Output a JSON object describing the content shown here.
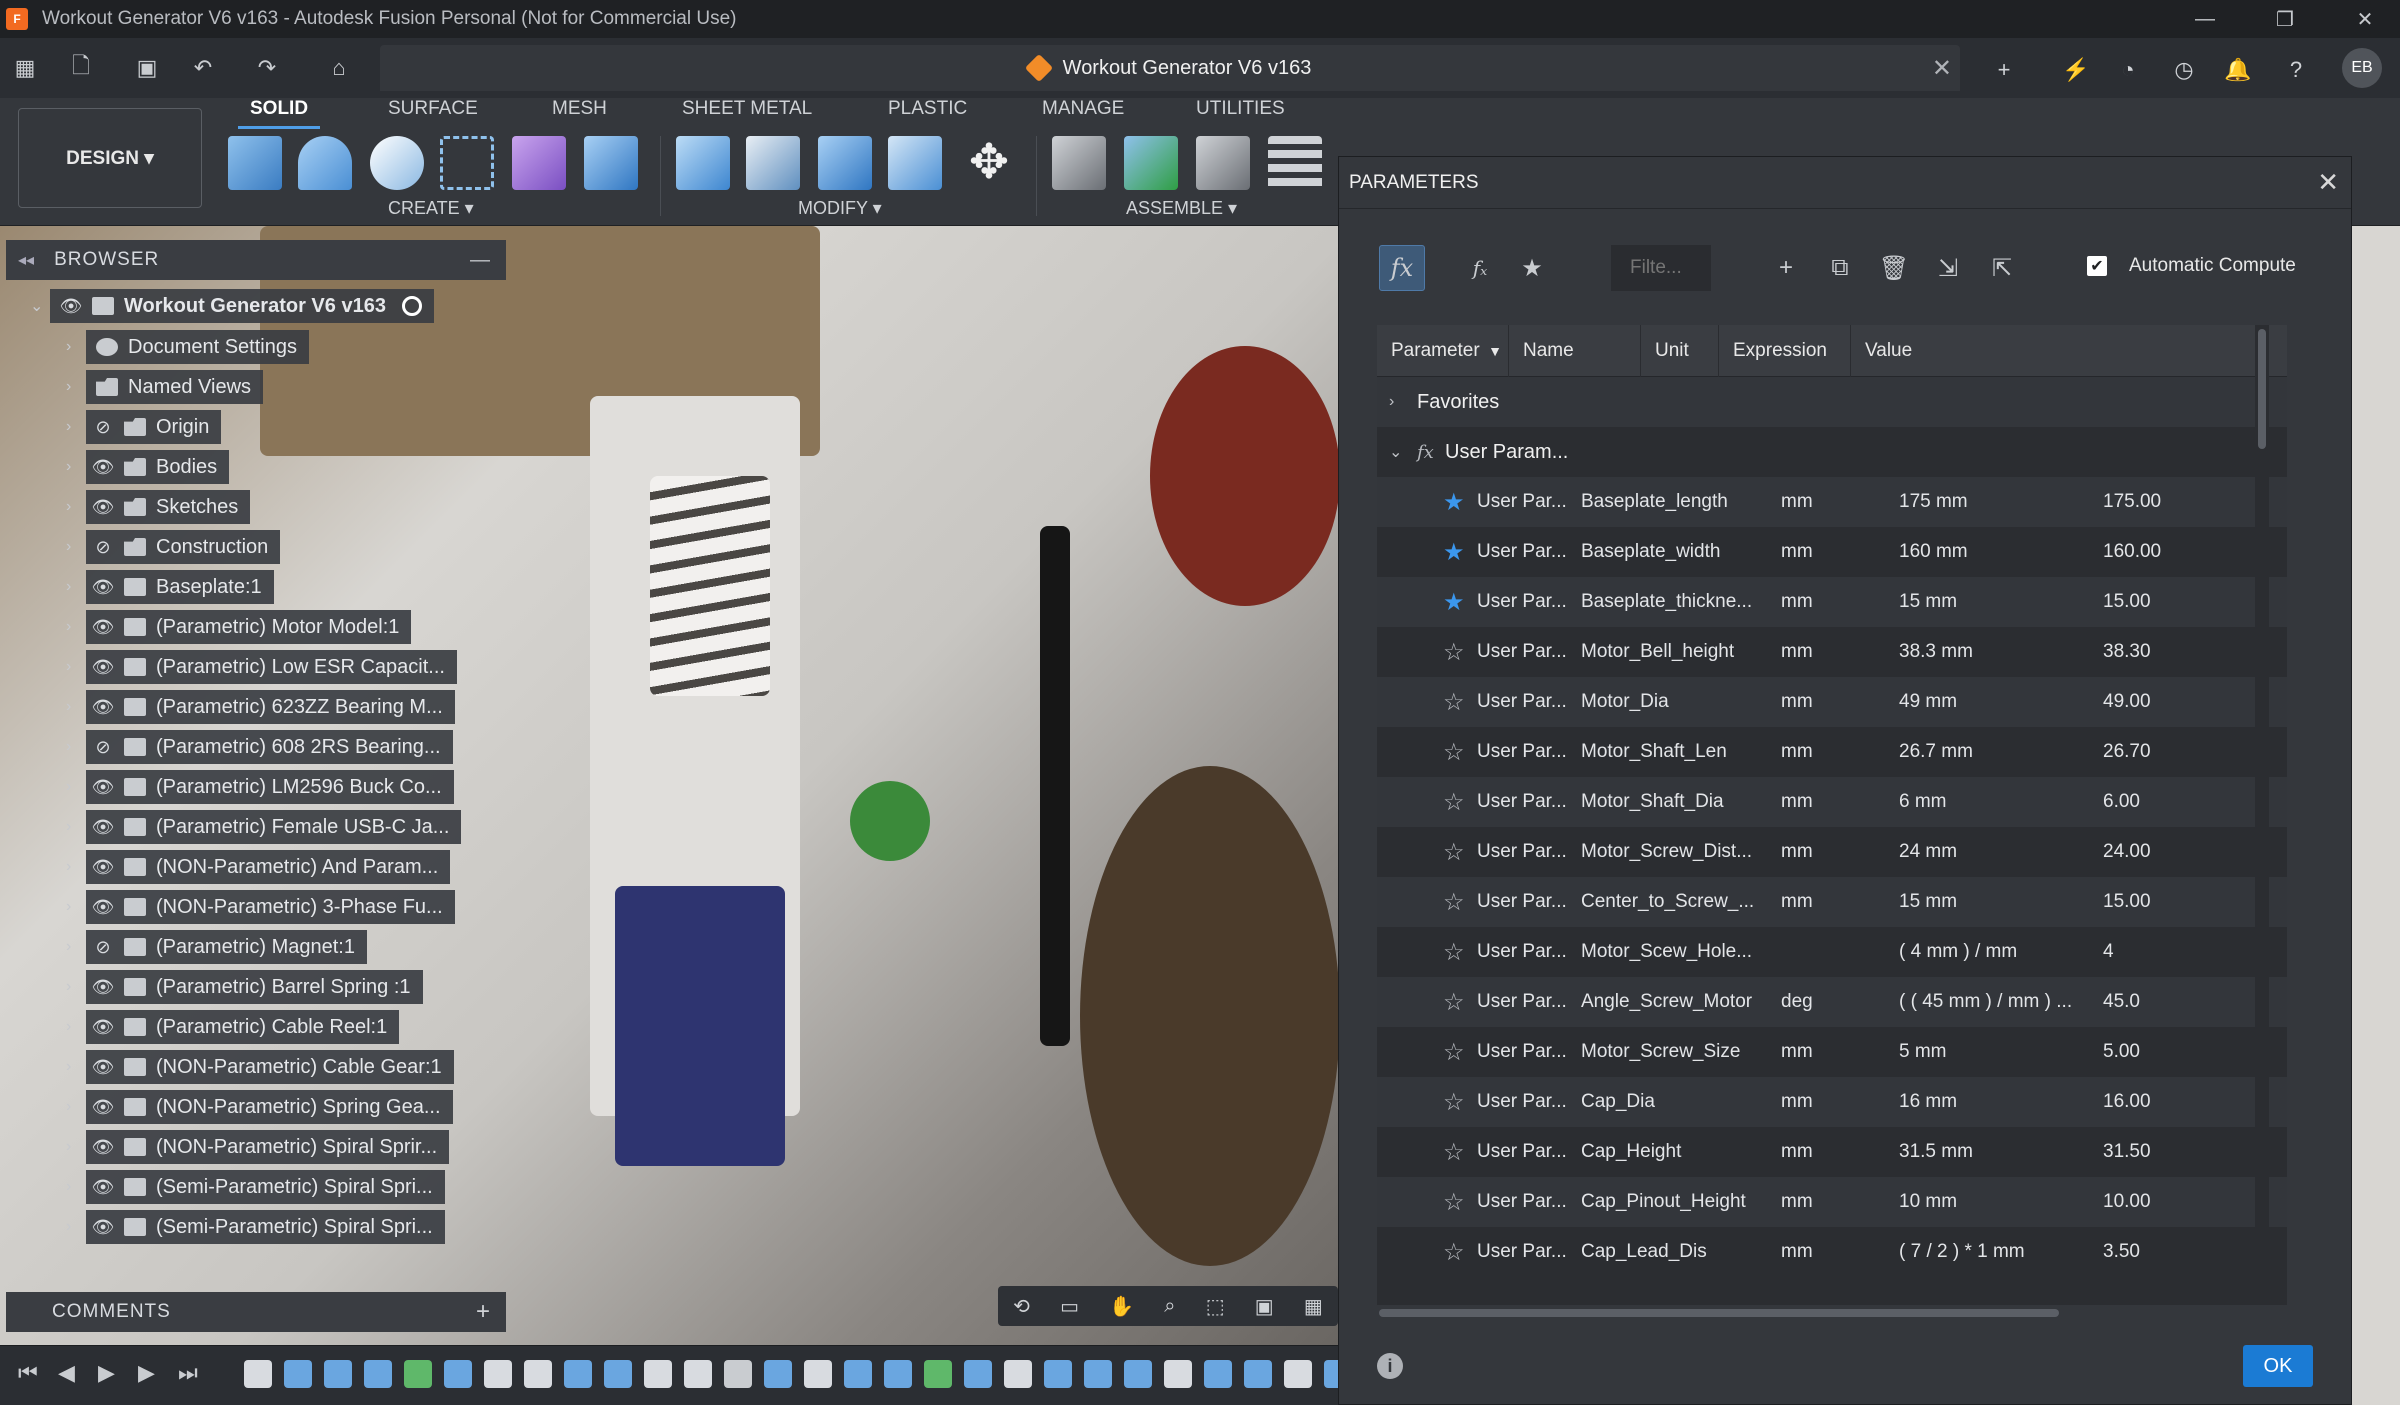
{
  "window": {
    "title": "Workout Generator V6 v163 - Autodesk Fusion Personal (Not for Commercial Use)",
    "app_icon_text": "F",
    "controls": [
      "—",
      "❐",
      "✕"
    ]
  },
  "document_tab": {
    "label": "Workout Generator V6 v163",
    "close": "✕"
  },
  "user": {
    "initials": "EB"
  },
  "ribbon": {
    "workspace": "DESIGN ▾",
    "tabs": [
      "SOLID",
      "SURFACE",
      "MESH",
      "SHEET METAL",
      "PLASTIC",
      "MANAGE",
      "UTILITIES"
    ],
    "groups": [
      "CREATE ▾",
      "MODIFY ▾",
      "ASSEMBLE ▾"
    ]
  },
  "browser": {
    "title": "BROWSER",
    "collapse": "—",
    "root": "Workout Generator V6 v163",
    "items": [
      {
        "label": "Document Settings",
        "icon": "gear-icon",
        "eye": false
      },
      {
        "label": "Named Views",
        "icon": "folder-icon",
        "eye": false
      },
      {
        "label": "Origin",
        "icon": "folder-icon",
        "eye": true,
        "hidden": true
      },
      {
        "label": "Bodies",
        "icon": "folder-icon",
        "eye": true
      },
      {
        "label": "Sketches",
        "icon": "folder-icon",
        "eye": true
      },
      {
        "label": "Construction",
        "icon": "folder-icon",
        "eye": true,
        "hidden": true
      },
      {
        "label": "Baseplate:1",
        "icon": "component-icon",
        "eye": true
      },
      {
        "label": "(Parametric) Motor Model:1",
        "icon": "component-icon",
        "eye": true
      },
      {
        "label": "(Parametric) Low ESR Capacit...",
        "icon": "component-icon",
        "eye": true
      },
      {
        "label": "(Parametric) 623ZZ Bearing M...",
        "icon": "component-icon",
        "eye": true
      },
      {
        "label": "(Parametric) 608 2RS Bearing...",
        "icon": "component-icon",
        "eye": true,
        "hidden": true
      },
      {
        "label": "(Parametric) LM2596 Buck Co...",
        "icon": "component-icon",
        "eye": true
      },
      {
        "label": "(Parametric) Female USB-C Ja...",
        "icon": "component-icon",
        "eye": true
      },
      {
        "label": "(NON-Parametric) And Param...",
        "icon": "component-icon",
        "eye": true
      },
      {
        "label": "(NON-Parametric) 3-Phase Fu...",
        "icon": "component-icon",
        "eye": true
      },
      {
        "label": "(Parametric) Magnet:1",
        "icon": "component-icon",
        "eye": true,
        "hidden": true
      },
      {
        "label": "(Parametric) Barrel Spring :1",
        "icon": "component-icon",
        "eye": true
      },
      {
        "label": "(Parametric) Cable Reel:1",
        "icon": "component-icon",
        "eye": true
      },
      {
        "label": "(NON-Parametric) Cable Gear:1",
        "icon": "component-icon",
        "eye": true
      },
      {
        "label": "(NON-Parametric) Spring Gea...",
        "icon": "component-icon",
        "eye": true
      },
      {
        "label": "(NON-Parametric) Spiral Sprir...",
        "icon": "component-icon",
        "eye": true
      },
      {
        "label": "(Semi-Parametric) Spiral Spri...",
        "icon": "component-icon",
        "eye": true
      },
      {
        "label": "(Semi-Parametric) Spiral Spri...",
        "icon": "component-icon",
        "eye": true
      }
    ]
  },
  "comments": {
    "title": "COMMENTS",
    "add": "+"
  },
  "parameters": {
    "title": "PARAMETERS",
    "filter_placeholder": "Filte...",
    "auto_compute_label": "Automatic Compute",
    "auto_compute_checked": true,
    "columns": [
      "Parameter",
      "Name",
      "Unit",
      "Expression",
      "Value"
    ],
    "groups": {
      "favorites": "Favorites",
      "user": "User Param..."
    },
    "rows": [
      {
        "fav": true,
        "param": "User Par...",
        "name": "Baseplate_length",
        "unit": "mm",
        "expr": "175 mm",
        "value": "175.00"
      },
      {
        "fav": true,
        "param": "User Par...",
        "name": "Baseplate_width",
        "unit": "mm",
        "expr": "160 mm",
        "value": "160.00"
      },
      {
        "fav": true,
        "param": "User Par...",
        "name": "Baseplate_thickne...",
        "unit": "mm",
        "expr": "15 mm",
        "value": "15.00"
      },
      {
        "fav": false,
        "param": "User Par...",
        "name": "Motor_Bell_height",
        "unit": "mm",
        "expr": "38.3 mm",
        "value": "38.30"
      },
      {
        "fav": false,
        "param": "User Par...",
        "name": "Motor_Dia",
        "unit": "mm",
        "expr": "49 mm",
        "value": "49.00"
      },
      {
        "fav": false,
        "param": "User Par...",
        "name": "Motor_Shaft_Len",
        "unit": "mm",
        "expr": "26.7 mm",
        "value": "26.70"
      },
      {
        "fav": false,
        "param": "User Par...",
        "name": "Motor_Shaft_Dia",
        "unit": "mm",
        "expr": "6 mm",
        "value": "6.00"
      },
      {
        "fav": false,
        "param": "User Par...",
        "name": "Motor_Screw_Dist...",
        "unit": "mm",
        "expr": "24 mm",
        "value": "24.00"
      },
      {
        "fav": false,
        "param": "User Par...",
        "name": "Center_to_Screw_...",
        "unit": "mm",
        "expr": "15 mm",
        "value": "15.00"
      },
      {
        "fav": false,
        "param": "User Par...",
        "name": "Motor_Scew_Hole...",
        "unit": "",
        "expr": "( 4 mm ) / mm",
        "value": "4"
      },
      {
        "fav": false,
        "param": "User Par...",
        "name": "Angle_Screw_Motor",
        "unit": "deg",
        "expr": "( ( 45 mm ) / mm ) ...",
        "value": "45.0"
      },
      {
        "fav": false,
        "param": "User Par...",
        "name": "Motor_Screw_Size",
        "unit": "mm",
        "expr": "5 mm",
        "value": "5.00"
      },
      {
        "fav": false,
        "param": "User Par...",
        "name": "Cap_Dia",
        "unit": "mm",
        "expr": "16 mm",
        "value": "16.00"
      },
      {
        "fav": false,
        "param": "User Par...",
        "name": "Cap_Height",
        "unit": "mm",
        "expr": "31.5 mm",
        "value": "31.50"
      },
      {
        "fav": false,
        "param": "User Par...",
        "name": "Cap_Pinout_Height",
        "unit": "mm",
        "expr": "10 mm",
        "value": "10.00"
      },
      {
        "fav": false,
        "param": "User Par...",
        "name": "Cap_Lead_Dis",
        "unit": "mm",
        "expr": "( 7 / 2 ) * 1 mm",
        "value": "3.50"
      }
    ],
    "ok_label": "OK"
  },
  "colors": {
    "accent": "#1b7bd4",
    "favorite_star": "#3b97ee",
    "orange_doc": "#f28c28"
  }
}
